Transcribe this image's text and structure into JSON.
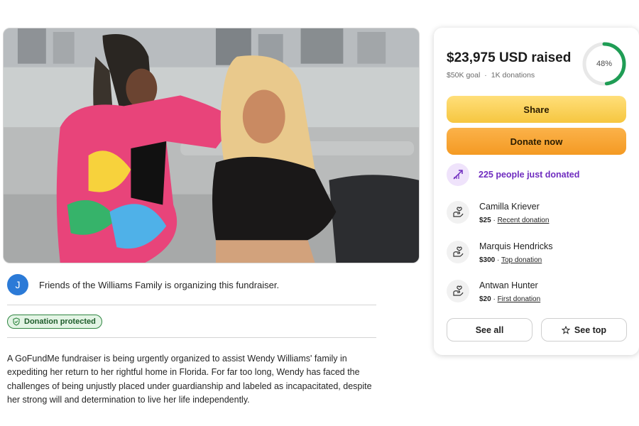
{
  "organizer": {
    "avatar_letter": "J",
    "text": "Friends of the Williams Family is organizing this fundraiser."
  },
  "badge": {
    "label": "Donation protected"
  },
  "description": "A GoFundMe fundraiser is being urgently organized to assist Wendy Williams' family in expediting her return to her rightful home in Florida. For far too long, Wendy has faced the challenges of being unjustly placed under guardianship and labeled as incapacitated, despite her strong will and determination to live her life independently.",
  "donation_card": {
    "raised": "$23,975 USD raised",
    "goal": "$50K goal",
    "separator": "·",
    "donations": "1K donations",
    "progress_label": "48%",
    "progress_fraction": 0.48,
    "share_label": "Share",
    "donate_label": "Donate now",
    "trend_text": "225 people just donated",
    "donors": [
      {
        "name": "Camilla Kriever",
        "amount": "$25",
        "sep": " · ",
        "tag": "Recent donation"
      },
      {
        "name": "Marquis Hendricks",
        "amount": "$300",
        "sep": " · ",
        "tag": "Top donation"
      },
      {
        "name": "Antwan Hunter",
        "amount": "$20",
        "sep": " · ",
        "tag": "First donation"
      }
    ],
    "see_all_label": "See all",
    "see_top_label": "See top"
  },
  "colors": {
    "progress": "#1f9d55",
    "progress_track": "#e8e8e8",
    "share_button": "#f6c640",
    "donate_button": "#f49a23",
    "trend_text": "#6f2cbf",
    "protected_border": "#2e8540"
  },
  "icons": {
    "trend": "trending-up-icon",
    "donor": "donation-hands-icon",
    "protected": "shield-check-icon",
    "see_top": "star-icon"
  }
}
